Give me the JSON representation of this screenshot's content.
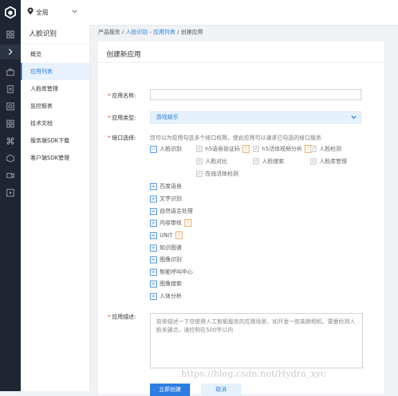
{
  "rail_icons": [
    "cube-logo-icon",
    "grid-icon",
    "chevron-right-icon",
    "briefcase-icon",
    "document-icon",
    "scan-icon",
    "apps-icon",
    "nodes-icon",
    "cube-icon",
    "video-icon",
    "play-icon"
  ],
  "topbar": {
    "region_label": "全局",
    "region_icon": "location-pin-icon"
  },
  "sidebar": {
    "title": "人脸识别",
    "items": [
      {
        "label": "概览",
        "active": false
      },
      {
        "label": "应用列表",
        "active": true
      },
      {
        "label": "人脸库管理",
        "active": false
      },
      {
        "label": "监控报表",
        "active": false
      },
      {
        "label": "技术文档",
        "active": false
      },
      {
        "label": "服务端SDK下载",
        "active": false
      },
      {
        "label": "客户端SDK管理",
        "active": false
      }
    ]
  },
  "breadcrumb": {
    "part1": "产品服务",
    "sep": "/",
    "part2": "人脸识别 - 应用列表",
    "part3": "创建应用"
  },
  "form": {
    "title": "创建新应用",
    "name_label": "应用名称:",
    "name_value": "",
    "type_label": "应用类型:",
    "type_value": "游戏娱乐",
    "api_label": "接口选择:",
    "api_hint": "您可以为应用勾选多个接口权限，使此应用可以请求已勾选的接口服务",
    "face": {
      "label": "人脸识别",
      "options": [
        "h5语音验证码",
        "h5活体视频分析",
        "人脸检测",
        "人脸对比",
        "人脸搜索",
        "人脸库管理",
        "在线活体检测"
      ]
    },
    "groups": [
      "百度语音",
      "文字识别",
      "自然语言处理",
      "内容审核",
      "UNIT",
      "知识图谱",
      "图像识别",
      "智能呼叫中心",
      "图像搜索",
      "人体分析"
    ],
    "desc_label": "应用描述:",
    "desc_placeholder": "简单描述一下您使用人工智能服务的应用场景，如开发一款美颜相机，需要检测人脸关键点，请控制在500字以内",
    "submit_label": "立即创建",
    "cancel_label": "取消"
  },
  "watermark": "https://blog.csdn.net/Hydra_xyc",
  "colors": {
    "accent": "#2d7ee3",
    "rail": "#1f2533",
    "warn": "#f08c1e"
  }
}
